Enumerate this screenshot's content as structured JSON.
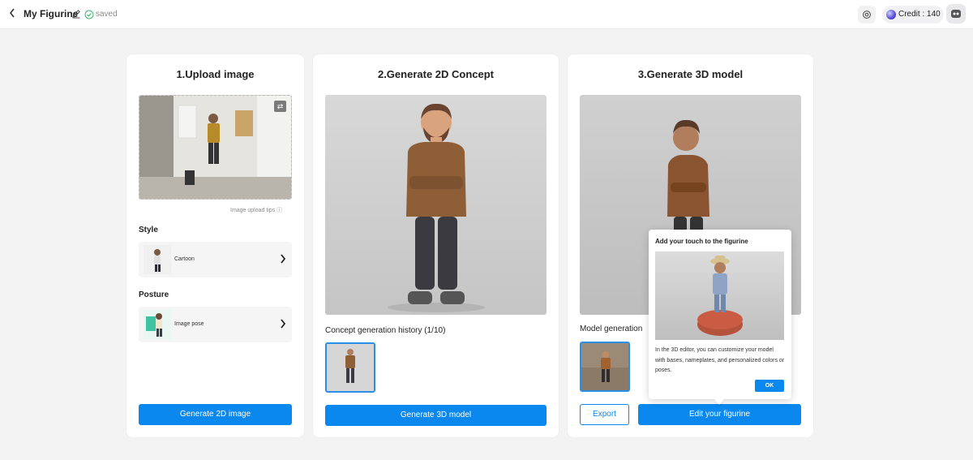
{
  "header": {
    "back_icon": "chevron-left-icon",
    "title": "My Figurine",
    "saved_text": "saved",
    "credit_label": "Credit : 140"
  },
  "steps": {
    "upload": {
      "title": "1.Upload image",
      "tips": "Image upload tips",
      "style_label": "Style",
      "style_value": "Cartoon",
      "posture_label": "Posture",
      "posture_value": "Image pose",
      "button": "Generate 2D image"
    },
    "concept": {
      "title": "2.Generate 2D Concept",
      "history_label": "Concept generation history (1/10)",
      "button": "Generate 3D model"
    },
    "model": {
      "title": "3.Generate 3D model",
      "history_label": "Model generation",
      "export_button": "Export",
      "edit_button": "Edit your figurine"
    }
  },
  "popup": {
    "title": "Add your touch to the figurine",
    "description": "In the 3D editor, you can customize your model with bases, nameplates, and personalized colors or poses.",
    "ok": "OK"
  },
  "colors": {
    "accent": "#0a88ee"
  }
}
